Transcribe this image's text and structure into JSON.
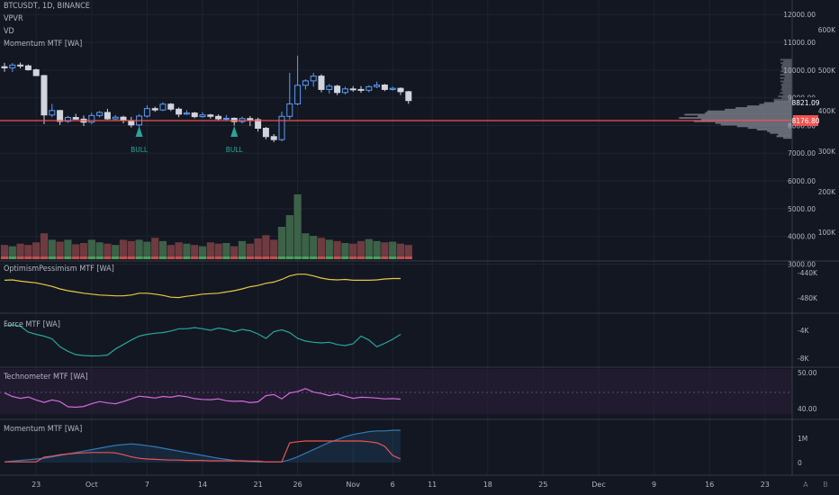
{
  "legend": {
    "symbol": "BTCUSDT, 1D, BINANCE",
    "indicators": [
      "VPVR",
      "VD",
      "Momentum MTF [WA]"
    ]
  },
  "panes": {
    "optimism": "OptimismPessimism MTF [WA]",
    "force": "Force MTF [WA]",
    "techno": "Technometer MTF [WA]",
    "momentum": "Momentum MTF [WA]"
  },
  "colors": {
    "background": "#131722",
    "up": "#5b9cf6",
    "down": "#d1d4dc",
    "hline": "#ef5350",
    "optimism": "#e5c843",
    "force": "#26a69a",
    "techno": "#d16ad9",
    "mom_red": "#ef5350",
    "mom_blue": "#2f7ab5",
    "signal": "#26a69a",
    "vol_up": "#3c6247",
    "vol_down": "#6f3a40"
  },
  "chart_data": [
    {
      "type": "candlestick",
      "title": "BTCUSDT, 1D, BINANCE",
      "ylim": [
        2700,
        12700
      ],
      "price_ticks": [
        12000,
        11000,
        10000,
        9000,
        8000,
        7000,
        6000,
        5000,
        4000,
        3000
      ],
      "price_tick_labels": [
        "12000.00",
        "11000.00",
        "10000.00",
        "9000.00",
        "8000.00",
        "7000.00",
        "6000.00",
        "5000.00",
        "4000.00",
        "3000.00"
      ],
      "current_price": "8821.09",
      "horizontal_line_label": "8176.80",
      "horizontal_line_value": 8176.8,
      "volume_ticks": [
        "600K",
        "500K",
        "400K",
        "300K",
        "200K",
        "100K"
      ],
      "x_labels": [
        {
          "index": 4,
          "label": "23"
        },
        {
          "index": 11,
          "label": "Oct"
        },
        {
          "index": 18,
          "label": "7"
        },
        {
          "index": 25,
          "label": "14"
        },
        {
          "index": 32,
          "label": "21"
        },
        {
          "index": 37,
          "label": "26"
        },
        {
          "index": 44,
          "label": "Nov"
        },
        {
          "index": 49,
          "label": "6"
        },
        {
          "index": 54,
          "label": "11"
        },
        {
          "index": 61,
          "label": "18"
        },
        {
          "index": 68,
          "label": "25"
        },
        {
          "index": 75,
          "label": "Dec"
        },
        {
          "index": 82,
          "label": "9"
        },
        {
          "index": 89,
          "label": "16"
        },
        {
          "index": 96,
          "label": "23"
        }
      ],
      "x_extra_labels": [
        "A",
        "B"
      ],
      "ohlc": [
        [
          10120,
          10260,
          9940,
          10080
        ],
        [
          10080,
          10250,
          9930,
          10180
        ],
        [
          10180,
          10270,
          10060,
          10150
        ],
        [
          10150,
          10200,
          9980,
          10010
        ],
        [
          10010,
          10050,
          9780,
          9800
        ],
        [
          9800,
          9830,
          8050,
          8380
        ],
        [
          8380,
          8780,
          8300,
          8540
        ],
        [
          8540,
          8560,
          8020,
          8150
        ],
        [
          8150,
          8350,
          8100,
          8290
        ],
        [
          8290,
          8420,
          8210,
          8230
        ],
        [
          8230,
          8360,
          7980,
          8120
        ],
        [
          8120,
          8460,
          8050,
          8360
        ],
        [
          8360,
          8520,
          8290,
          8470
        ],
        [
          8470,
          8600,
          8210,
          8240
        ],
        [
          8240,
          8380,
          8170,
          8300
        ],
        [
          8300,
          8350,
          8080,
          8180
        ],
        [
          8180,
          8310,
          7930,
          8020
        ],
        [
          8020,
          8410,
          7950,
          8340
        ],
        [
          8340,
          8730,
          8280,
          8610
        ],
        [
          8610,
          8680,
          8490,
          8560
        ],
        [
          8560,
          8840,
          8520,
          8770
        ],
        [
          8770,
          8810,
          8520,
          8590
        ],
        [
          8590,
          8650,
          8300,
          8410
        ],
        [
          8410,
          8550,
          8380,
          8450
        ],
        [
          8450,
          8490,
          8260,
          8320
        ],
        [
          8320,
          8480,
          8280,
          8380
        ],
        [
          8380,
          8420,
          8250,
          8330
        ],
        [
          8330,
          8400,
          8180,
          8240
        ],
        [
          8240,
          8380,
          8160,
          8260
        ],
        [
          8260,
          8290,
          8000,
          8140
        ],
        [
          8140,
          8320,
          8070,
          8250
        ],
        [
          8250,
          8340,
          7980,
          8210
        ],
        [
          8210,
          8280,
          7780,
          7900
        ],
        [
          7900,
          7950,
          7500,
          7600
        ],
        [
          7600,
          7690,
          7400,
          7490
        ],
        [
          7490,
          8500,
          7430,
          8330
        ],
        [
          8330,
          9900,
          8220,
          8780
        ],
        [
          8780,
          10520,
          8730,
          9450
        ],
        [
          9450,
          9670,
          9300,
          9610
        ],
        [
          9610,
          9900,
          9400,
          9780
        ],
        [
          9780,
          9850,
          9200,
          9300
        ],
        [
          9300,
          9500,
          9150,
          9420
        ],
        [
          9420,
          9470,
          9100,
          9190
        ],
        [
          9190,
          9400,
          9120,
          9320
        ],
        [
          9320,
          9420,
          9220,
          9300
        ],
        [
          9300,
          9420,
          9180,
          9270
        ],
        [
          9270,
          9450,
          9200,
          9400
        ],
        [
          9400,
          9580,
          9350,
          9460
        ],
        [
          9460,
          9500,
          9240,
          9300
        ],
        [
          9300,
          9400,
          9260,
          9340
        ],
        [
          9340,
          9380,
          9100,
          9220
        ],
        [
          9220,
          9250,
          8780,
          8900
        ]
      ],
      "volume": [
        0.22,
        0.2,
        0.24,
        0.22,
        0.26,
        0.4,
        0.3,
        0.27,
        0.3,
        0.23,
        0.25,
        0.3,
        0.26,
        0.24,
        0.22,
        0.3,
        0.28,
        0.3,
        0.27,
        0.33,
        0.28,
        0.22,
        0.26,
        0.24,
        0.22,
        0.2,
        0.26,
        0.24,
        0.25,
        0.2,
        0.28,
        0.24,
        0.32,
        0.37,
        0.3,
        0.5,
        0.68,
        1.0,
        0.4,
        0.36,
        0.33,
        0.3,
        0.28,
        0.25,
        0.24,
        0.28,
        0.31,
        0.28,
        0.26,
        0.27,
        0.24,
        0.22
      ],
      "signals": [
        {
          "index": 17,
          "label": "BULL"
        },
        {
          "index": 29,
          "label": "BULL"
        }
      ]
    },
    {
      "type": "line",
      "title": "OptimismPessimism MTF [WA]",
      "y_ticks": [
        "-440K",
        "-480K"
      ],
      "series": [
        {
          "values": [
            0.72,
            0.73,
            0.7,
            0.68,
            0.66,
            0.62,
            0.58,
            0.52,
            0.48,
            0.45,
            0.42,
            0.4,
            0.38,
            0.37,
            0.36,
            0.36,
            0.38,
            0.42,
            0.42,
            0.4,
            0.37,
            0.33,
            0.32,
            0.35,
            0.37,
            0.4,
            0.41,
            0.42,
            0.45,
            0.48,
            0.52,
            0.57,
            0.6,
            0.65,
            0.68,
            0.74,
            0.82,
            0.86,
            0.86,
            0.82,
            0.77,
            0.74,
            0.73,
            0.74,
            0.72,
            0.72,
            0.72,
            0.73,
            0.75,
            0.76,
            0.76
          ]
        }
      ]
    },
    {
      "type": "line",
      "title": "Force MTF [WA]",
      "y_ticks": [
        "-4K",
        "-8K"
      ],
      "series": [
        {
          "values": [
            0.68,
            0.72,
            0.66,
            0.4,
            0.3,
            0.22,
            0.1,
            -0.25,
            -0.45,
            -0.6,
            -0.64,
            -0.66,
            -0.65,
            -0.62,
            -0.35,
            -0.15,
            0.05,
            0.22,
            0.3,
            0.35,
            0.38,
            0.45,
            0.55,
            0.55,
            0.6,
            0.55,
            0.48,
            0.58,
            0.52,
            0.42,
            0.52,
            0.46,
            0.32,
            0.12,
            0.42,
            0.5,
            0.38,
            0.12,
            0.0,
            -0.05,
            -0.08,
            -0.05,
            -0.15,
            -0.2,
            -0.12,
            0.22,
            0.05,
            -0.25,
            -0.1,
            0.08,
            0.3
          ]
        }
      ]
    },
    {
      "type": "line",
      "title": "Technometer MTF [WA]",
      "y_ticks": [
        "50.00",
        "40.00"
      ],
      "series": [
        {
          "values": [
            45.8,
            44.5,
            43.8,
            44.3,
            43.2,
            42.3,
            43.2,
            42.6,
            40.7,
            40.5,
            40.8,
            41.8,
            42.6,
            42.1,
            41.8,
            42.6,
            43.6,
            44.6,
            44.3,
            43.9,
            44.5,
            44.2,
            44.8,
            44.4,
            43.7,
            43.4,
            43.3,
            43.6,
            42.9,
            42.7,
            42.8,
            42.2,
            42.5,
            44.8,
            45.2,
            43.6,
            45.8,
            46.3,
            47.4,
            46.1,
            45.6,
            44.8,
            45.4,
            44.6,
            43.8,
            44.2,
            44.1,
            43.9,
            43.6,
            43.7,
            43.5
          ]
        }
      ]
    },
    {
      "type": "area",
      "title": "Momentum MTF [WA]",
      "y_ticks": [
        "1M",
        "0"
      ],
      "series": [
        {
          "values": [
            0.02,
            0.02,
            0.02,
            0.02,
            0.02,
            0.15,
            0.18,
            0.22,
            0.24,
            0.26,
            0.27,
            0.28,
            0.28,
            0.28,
            0.27,
            0.22,
            0.16,
            0.12,
            0.1,
            0.09,
            0.08,
            0.07,
            0.07,
            0.06,
            0.06,
            0.06,
            0.05,
            0.05,
            0.05,
            0.05,
            0.05,
            0.04,
            0.04,
            0.02,
            0.02,
            0.02,
            0.55,
            0.58,
            0.6,
            0.6,
            0.6,
            0.6,
            0.6,
            0.6,
            0.6,
            0.6,
            0.58,
            0.55,
            0.45,
            0.2,
            0.1
          ]
        },
        {
          "values": [
            0.02,
            0.04,
            0.06,
            0.08,
            0.1,
            0.12,
            0.16,
            0.2,
            0.24,
            0.28,
            0.32,
            0.36,
            0.4,
            0.44,
            0.48,
            0.5,
            0.52,
            0.5,
            0.47,
            0.44,
            0.4,
            0.36,
            0.32,
            0.28,
            0.24,
            0.2,
            0.16,
            0.12,
            0.09,
            0.06,
            0.04,
            0.03,
            0.02,
            0.02,
            0.02,
            0.02,
            0.08,
            0.16,
            0.26,
            0.36,
            0.46,
            0.56,
            0.64,
            0.72,
            0.78,
            0.82,
            0.86,
            0.88,
            0.88,
            0.9,
            0.9
          ]
        }
      ]
    }
  ]
}
